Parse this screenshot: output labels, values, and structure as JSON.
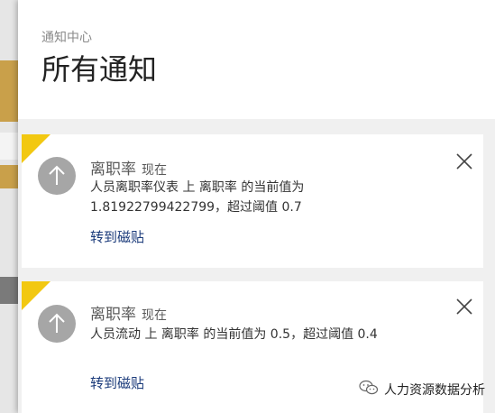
{
  "panel": {
    "subtitle": "通知中心",
    "title": "所有通知"
  },
  "notifications": [
    {
      "metric": "离职率",
      "time": "现在",
      "message": "人员离职率仪表 上 离职率 的当前值为 1.81922799422799，超过阈值 0.7",
      "link": "转到磁贴",
      "avatar_icon": "arrow-up-icon",
      "accent_color": "#f2c811"
    },
    {
      "metric": "离职率",
      "time": "现在",
      "message": "人员流动 上 离职率 的当前值为 0.5，超过阈值 0.4",
      "link": "转到磁贴",
      "avatar_icon": "arrow-up-icon",
      "accent_color": "#f2c811"
    }
  ],
  "watermark": {
    "text": "人力资源数据分析",
    "icon": "wechat-icon"
  }
}
